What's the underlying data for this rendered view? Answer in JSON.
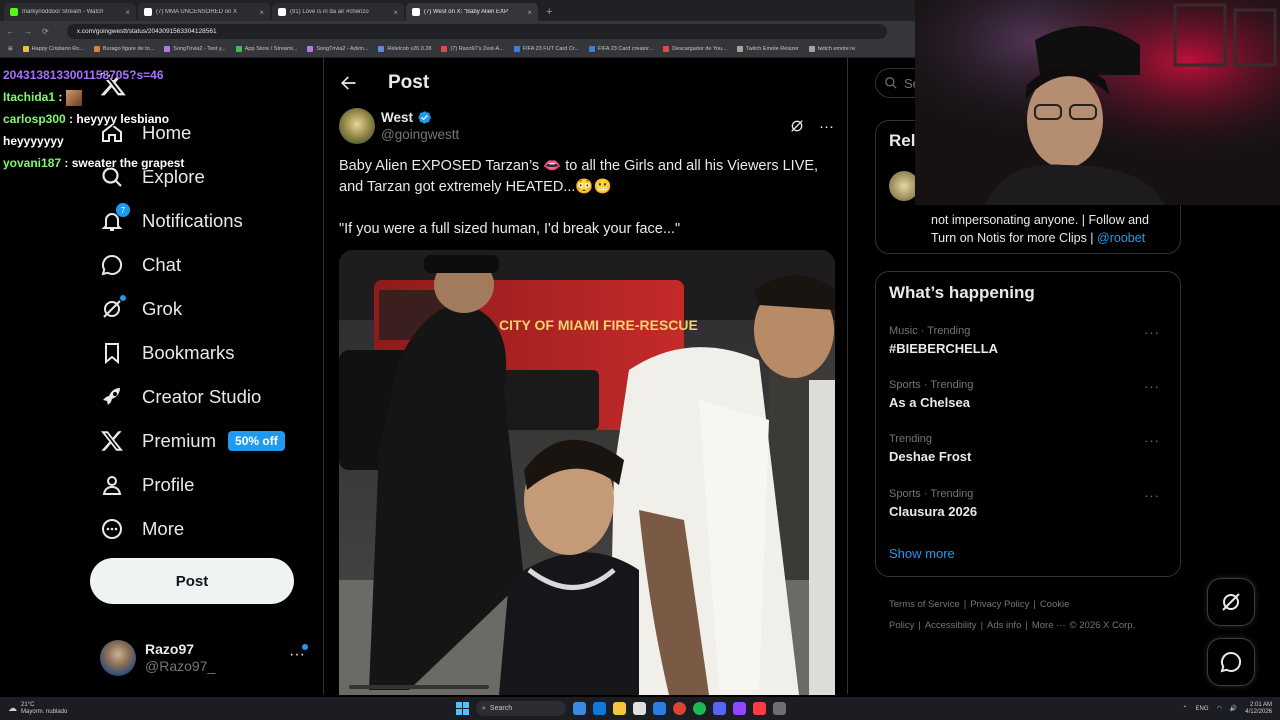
{
  "browser": {
    "tabs": [
      {
        "title": "markynoddoor Stream - Watch",
        "color": "#53fc18",
        "active": false
      },
      {
        "title": "(7) MMA UNCENSORED on X",
        "color": "#ffffff",
        "active": false
      },
      {
        "title": "(91) Love is in da air #chenzo",
        "color": "#ffffff",
        "active": false
      },
      {
        "title": "(7) West on X: \"Baby Alien EXP",
        "color": "#ffffff",
        "active": true
      }
    ],
    "new_tab": "+",
    "url": "x.com/goingwestt/status/2043091563304128561",
    "bookmarks": [
      {
        "label": "Happy Cristiano Ro...",
        "color": "#e8c33b"
      },
      {
        "label": "Burago figure de to...",
        "color": "#e37d3a"
      },
      {
        "label": "SongTrivia2 - Test y...",
        "color": "#b27ce0"
      },
      {
        "label": "App Store / Streami...",
        "color": "#3ac05a"
      },
      {
        "label": "SongTrivia2 - Advin...",
        "color": "#b27ce0"
      },
      {
        "label": "Relelcob v26.0.28",
        "color": "#5a8de0"
      },
      {
        "label": "(7) Razo97's Zest-A...",
        "color": "#e04a4a"
      },
      {
        "label": "FIFA 23 FUT Card Cr...",
        "color": "#3a7fe0"
      },
      {
        "label": "FIFA 23 Card creator...",
        "color": "#3a7fe0"
      },
      {
        "label": "Descargador de You...",
        "color": "#e04a4a"
      },
      {
        "label": "Twitch Emote Resizer",
        "color": "#a3a3a3"
      },
      {
        "label": "twitch emote re",
        "color": "#a3a3a3"
      }
    ]
  },
  "chat": {
    "lines": [
      {
        "user": "",
        "text": "2043138133001158705?s=46",
        "color": "#a970ff"
      },
      {
        "user": "Itachida1",
        "text": " :",
        "color": "#7cfc6a",
        "emote": true
      },
      {
        "user": "carlosp300",
        "text": " : heyyyy lesbiano",
        "color": "#7cfc6a"
      },
      {
        "user": "",
        "text": "heyyyyyyy",
        "color": "#ffffff"
      },
      {
        "user": "yovani187",
        "text": " : sweater the grapest",
        "color": "#7cfc6a"
      }
    ]
  },
  "nav": {
    "items": [
      {
        "label": "Home",
        "icon": "home-icon"
      },
      {
        "label": "Explore",
        "icon": "search-icon"
      },
      {
        "label": "Notifications",
        "icon": "bell-icon",
        "badge": "7"
      },
      {
        "label": "Chat",
        "icon": "chat-icon"
      },
      {
        "label": "Grok",
        "icon": "grok-icon",
        "dot": true
      },
      {
        "label": "Bookmarks",
        "icon": "bookmark-icon"
      },
      {
        "label": "Creator Studio",
        "icon": "rocket-icon"
      },
      {
        "label": "Premium",
        "icon": "x-icon",
        "tag": "50% off"
      },
      {
        "label": "Profile",
        "icon": "person-icon"
      },
      {
        "label": "More",
        "icon": "more-circle-icon"
      }
    ],
    "post_button": "Post",
    "account": {
      "name": "Razo97",
      "handle": "@Razo97_"
    }
  },
  "main": {
    "header_title": "Post",
    "tweet": {
      "author_name": "West",
      "author_handle": "@goingwestt",
      "text_line1": "Baby Alien EXPOSED Tarzan’s 👄 to all the Girls and all his Viewers LIVE, and Tarzan got extremely HEATED...😳😬",
      "text_line2": "\"If you were a full sized human, I'd break your face...\"",
      "media_text": "CITY OF MIAMI FIRE-RESCUE"
    }
  },
  "right": {
    "search_placeholder": "Se",
    "relevant_title": "Rel",
    "relevant_bio": "not impersonating anyone. | Follow and Turn on Notis for more Clips | ",
    "relevant_bio_link": "@roobet",
    "happening_title": "What’s happening",
    "trends": [
      {
        "meta": "Music · Trending",
        "name": "#BIEBERCHELLA"
      },
      {
        "meta": "Sports · Trending",
        "name": "As a Chelsea"
      },
      {
        "meta": "Trending",
        "name": "Deshae Frost"
      },
      {
        "meta": "Sports · Trending",
        "name": "Clausura 2026"
      }
    ],
    "show_more": "Show more",
    "footer": [
      "Terms of Service",
      "|",
      "Privacy Policy",
      "|",
      "Cookie Policy",
      "|",
      "Accessibility",
      "|",
      "Ads info",
      "|",
      "More ···",
      "© 2026 X Corp."
    ]
  },
  "taskbar": {
    "weather_temp": "21°C",
    "weather_desc": "Mayorm. nublado",
    "search_label": "Search",
    "lang": "ENG",
    "time": "2:01 AM",
    "date": "4/12/2026"
  },
  "colors": {
    "accent": "#1d9bf0",
    "background": "#000000",
    "border": "#2f3336",
    "muted": "#71767b"
  }
}
